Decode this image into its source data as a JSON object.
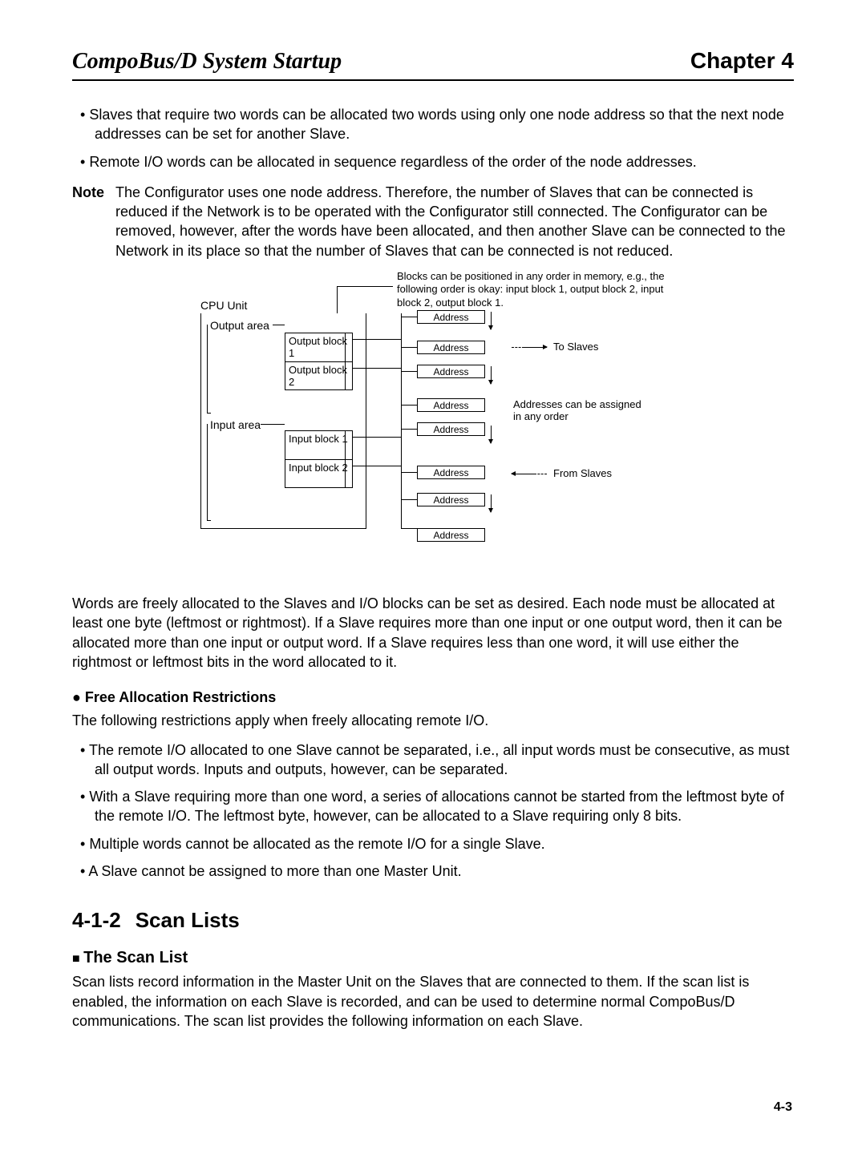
{
  "header": {
    "left": "CompoBus/D System Startup",
    "right": "Chapter 4"
  },
  "top_bullets": [
    "Slaves that require two words can be allocated two words using only one node address so that the next node addresses can be set for another Slave.",
    "Remote I/O words can be allocated in sequence regardless of the order of the node addresses."
  ],
  "note": {
    "label": "Note",
    "text": "The Configurator uses one node address. Therefore, the number of Slaves that can be connected is reduced if the Network is to be operated with the Configurator still connected. The Configurator can be removed, however, after the words have been allocated, and then another Slave can be connected to the Network in its place so that the number of Slaves that can be connected is not reduced."
  },
  "diagram": {
    "cpu_label": "CPU Unit",
    "output_area_label": "Output area",
    "input_area_label": "Input area",
    "blocks": {
      "ob1": "Output block 1",
      "ob2": "Output block 2",
      "ib1": "Input block 1",
      "ib2": "Input block 2"
    },
    "addr_label": "Address",
    "top_annot": "Blocks can be positioned in any order in memory, e.g., the following order is okay: input block 1, output block 2, input block 2, output block 1.",
    "to_slaves": "To Slaves",
    "from_slaves": "From Slaves",
    "any_order": "Addresses can be assigned in any order"
  },
  "after_diagram": "Words are freely allocated to the Slaves and I/O blocks can be set as desired. Each node must be allocated at least one byte (leftmost or rightmost). If a Slave requires more than one input or one output word, then it can be allocated more than one input or output word. If a Slave requires less than one word, it will use either the rightmost or leftmost bits in the word allocated to it.",
  "restrictions": {
    "heading": "Free Allocation Restrictions",
    "intro": "The following restrictions apply when freely allocating remote I/O.",
    "items": [
      "The remote I/O allocated to one Slave cannot be separated, i.e., all input words must be consecutive, as must all output words. Inputs and outputs, however, can be separated.",
      "With a Slave requiring more than one word, a series of allocations cannot be started from the leftmost byte of the remote I/O. The leftmost byte, however, can be allocated to a Slave requiring only 8 bits.",
      "Multiple words cannot be allocated as the remote I/O for a single Slave.",
      "A Slave cannot be assigned to more than one Master Unit."
    ]
  },
  "scan": {
    "section_num": "4-1-2",
    "section_title": "Scan Lists",
    "sub_heading": "The Scan List",
    "text": "Scan lists record information in the Master Unit on the Slaves that are connected to them. If the scan list is enabled, the information on each Slave is recorded, and can be used to determine normal CompoBus/D communications. The scan list provides the following information on each Slave."
  },
  "page_number": "4-3"
}
